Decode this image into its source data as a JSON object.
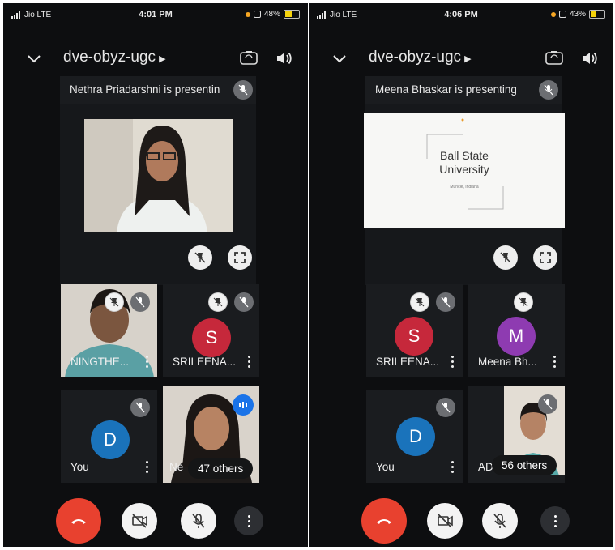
{
  "left_phone": {
    "status": {
      "carrier": "Jio  LTE",
      "time": "4:01 PM",
      "battery": "48%"
    },
    "meeting_title": "dve-obyz-ugc",
    "presenting_text": "Nethra Priadarshni is presentin",
    "tiles": [
      {
        "name": "NINGTHE...",
        "type": "video"
      },
      {
        "name": "SRILEENA...",
        "initial": "S",
        "color": "#c6283b"
      },
      {
        "name": "You",
        "initial": "D",
        "color": "#1a73bb"
      },
      {
        "name": "Ne",
        "others": "47 others",
        "type": "video"
      }
    ]
  },
  "right_phone": {
    "status": {
      "carrier": "Jio  LTE",
      "time": "4:06 PM",
      "battery": "43%"
    },
    "meeting_title": "dve-obyz-ugc",
    "presenting_text": "Meena Bhaskar is presenting",
    "slide": {
      "title_line1": "Ball State",
      "title_line2": "University",
      "subtitle": "Muncie, Indiana"
    },
    "tiles": [
      {
        "name": "SRILEENA...",
        "initial": "S",
        "color": "#c6283b"
      },
      {
        "name": "Meena Bh...",
        "initial": "M",
        "color": "#8e3bb1"
      },
      {
        "name": "You",
        "initial": "D",
        "color": "#1a73bb"
      },
      {
        "name": "AD",
        "others": "56 others",
        "type": "video"
      }
    ]
  },
  "icons": {
    "chevron": "chevron-down-icon",
    "camera_switch": "camera-switch-icon",
    "speaker": "speaker-icon",
    "mic_off": "mic-off-icon",
    "pin": "pin-icon",
    "fullscreen": "fullscreen-icon",
    "end_call": "end-call-icon",
    "video_off": "video-off-icon",
    "more": "more-vert-icon"
  }
}
